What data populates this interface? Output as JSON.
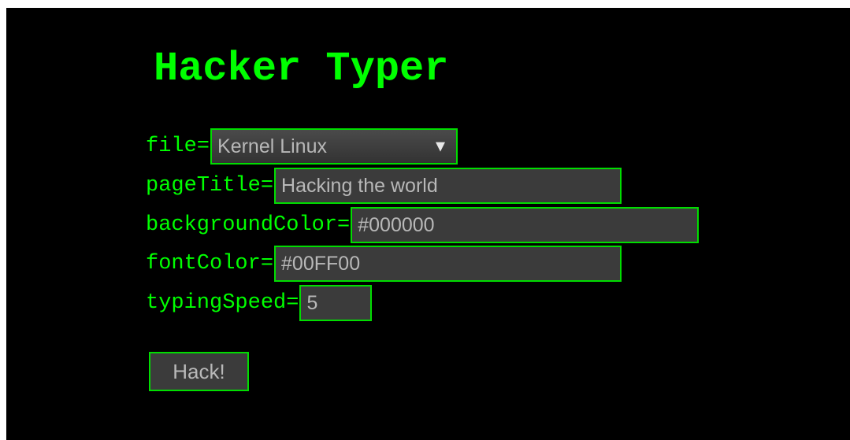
{
  "app": {
    "title": "Hacker Typer"
  },
  "form": {
    "file": {
      "label": "file=",
      "selected": "Kernel Linux"
    },
    "pageTitle": {
      "label": "pageTitle=",
      "value": "Hacking the world"
    },
    "backgroundColor": {
      "label": "backgroundColor=",
      "value": "#000000"
    },
    "fontColor": {
      "label": "fontColor=",
      "value": "#00FF00"
    },
    "typingSpeed": {
      "label": "typingSpeed=",
      "value": "5"
    },
    "submit_label": "Hack!"
  },
  "icons": {
    "dropdown": "chevron-down-icon"
  },
  "colors": {
    "background": "#000000",
    "accent": "#00FF00",
    "field_background": "#3B3B3B",
    "field_text": "#B8B8B8"
  }
}
